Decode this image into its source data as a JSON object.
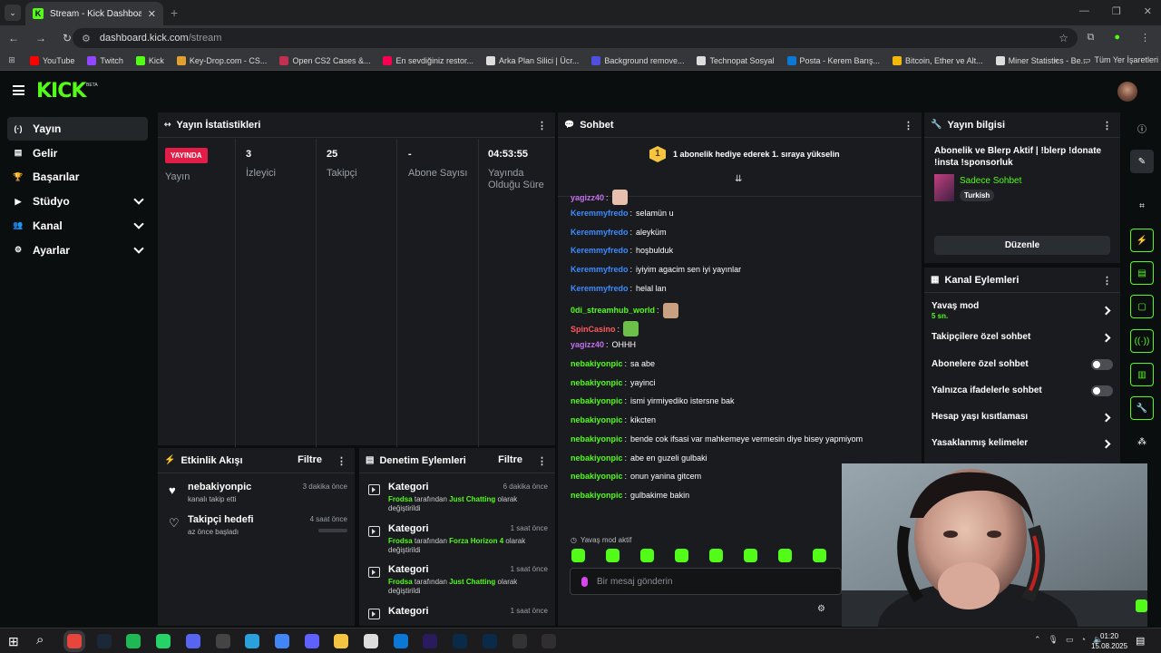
{
  "browser": {
    "tab_title": "Stream - Kick Dashboard",
    "url_host": "dashboard.kick.com",
    "url_path": "/stream",
    "bookmarks": [
      {
        "label": "YouTube",
        "color": "#ff0000"
      },
      {
        "label": "Twitch",
        "color": "#9146ff"
      },
      {
        "label": "Kick",
        "color": "#53fc18"
      },
      {
        "label": "Key-Drop.com - CS...",
        "color": "#e0a030"
      },
      {
        "label": "Open CS2 Cases &...",
        "color": "#c03050"
      },
      {
        "label": "En sevdiğiniz restor...",
        "color": "#fa0050"
      },
      {
        "label": "Arka Plan Silici | Ücr...",
        "color": "#dddddd"
      },
      {
        "label": "Background remove...",
        "color": "#5050e0"
      },
      {
        "label": "Technopat Sosyal",
        "color": "#dddddd"
      },
      {
        "label": "Posta - Kerem Barış...",
        "color": "#0a78d4"
      },
      {
        "label": "Bitcoin, Ether ve Alt...",
        "color": "#f0b90b"
      },
      {
        "label": "Miner Statistics - Be...",
        "color": "#dddddd"
      }
    ],
    "all_bookmarks": "Tüm Yer İşaretleri"
  },
  "kick": {
    "logo": "KICK",
    "beta": "BETA"
  },
  "sidebar": {
    "items": [
      {
        "label": "Yayın",
        "icon": "(·)",
        "active": true,
        "expandable": false
      },
      {
        "label": "Gelir",
        "icon": "▤",
        "active": false,
        "expandable": false
      },
      {
        "label": "Başarılar",
        "icon": "🏆",
        "active": false,
        "expandable": false
      },
      {
        "label": "Stüdyo",
        "icon": "▶",
        "active": false,
        "expandable": true
      },
      {
        "label": "Kanal",
        "icon": "👥",
        "active": false,
        "expandable": true
      },
      {
        "label": "Ayarlar",
        "icon": "⚙",
        "active": false,
        "expandable": true
      }
    ]
  },
  "stats": {
    "title": "Yayın İstatistikleri",
    "live_badge": "YAYINDA",
    "live_label": "Yayın",
    "items": [
      {
        "value": "3",
        "label": "İzleyici"
      },
      {
        "value": "25",
        "label": "Takipçi"
      },
      {
        "value": "-",
        "label": "Abone Sayısı"
      },
      {
        "value": "04:53:55",
        "label": "Yayında Olduğu Süre"
      }
    ]
  },
  "activity": {
    "title": "Etkinlik Akışı",
    "filter": "Filtre",
    "items": [
      {
        "title": "nebakiyonpic",
        "sub": "kanalı takip etti",
        "when": "3 dakika önce"
      },
      {
        "title": "Takipçi hedefi",
        "sub": "az önce başladı",
        "when": "4 saat önce"
      }
    ]
  },
  "moderation": {
    "title": "Denetim Eylemleri",
    "filter": "Filtre",
    "items": [
      {
        "title": "Kategori",
        "when": "6 dakika önce",
        "by": "Frodsa",
        "mid": "tarafından",
        "cat": "Just Chatting",
        "tail": "olarak değiştirildi"
      },
      {
        "title": "Kategori",
        "when": "1 saat önce",
        "by": "Frodsa",
        "mid": "tarafından",
        "cat": "Forza Horizon 4",
        "tail": "olarak değiştirildi"
      },
      {
        "title": "Kategori",
        "when": "1 saat önce",
        "by": "Frodsa",
        "mid": "tarafından",
        "cat": "Just Chatting",
        "tail": "olarak değiştirildi"
      },
      {
        "title": "Kategori",
        "when": "1 saat önce",
        "by": "",
        "mid": "",
        "cat": "",
        "tail": ""
      }
    ]
  },
  "chat": {
    "title": "Sohbet",
    "pinned_badge": "1",
    "pinned": "1 abonelik hediye ederek 1. sıraya yükselin",
    "slow_mode_note": "Yavaş mod aktif",
    "placeholder": "Bir mesaj gönderin",
    "messages": [
      {
        "user": "yagizz40",
        "color": "#c471ed",
        "text": "",
        "emote": "#e8c0b0"
      },
      {
        "user": "Keremmyfredo",
        "color": "#3d8bff",
        "text": "selamün u"
      },
      {
        "user": "Keremmyfredo",
        "color": "#3d8bff",
        "text": "aleyküm"
      },
      {
        "user": "Keremmyfredo",
        "color": "#3d8bff",
        "text": "hoşbulduk"
      },
      {
        "user": "Keremmyfredo",
        "color": "#3d8bff",
        "text": "iyiyim agacim sen iyi yayınlar"
      },
      {
        "user": "Keremmyfredo",
        "color": "#3d8bff",
        "text": "helal lan"
      },
      {
        "user": "0di_streamhub_world",
        "color": "#53fc18",
        "text": "",
        "emote": "#c9a080"
      },
      {
        "user": "SpinCasino",
        "color": "#ff5a5f",
        "text": "",
        "emote": "#6cc04a"
      },
      {
        "user": "yagizz40",
        "color": "#c471ed",
        "text": "OHHH"
      },
      {
        "user": "nebakiyonpic",
        "color": "#53fc18",
        "text": "sa abe"
      },
      {
        "user": "nebakiyonpic",
        "color": "#53fc18",
        "text": "yayinci"
      },
      {
        "user": "nebakiyonpic",
        "color": "#53fc18",
        "text": "ismi yirmiyediko istersne bak"
      },
      {
        "user": "nebakiyonpic",
        "color": "#53fc18",
        "text": "kikcten"
      },
      {
        "user": "nebakiyonpic",
        "color": "#53fc18",
        "text": "bende cok ifsasi var mahkemeye vermesin diye bisey yapmiyom"
      },
      {
        "user": "nebakiyonpic",
        "color": "#53fc18",
        "text": "abe en guzeli gulbaki"
      },
      {
        "user": "nebakiyonpic",
        "color": "#53fc18",
        "text": "onun yanina gitcem"
      },
      {
        "user": "nebakiyonpic",
        "color": "#53fc18",
        "text": "gulbakime bakin"
      }
    ]
  },
  "stream_info": {
    "title": "Yayın bilgisi",
    "stream_title": "Abonelik ve Blerp Aktif | !blerp !donate !insta !sponsorluk",
    "category": "Sadece Sohbet",
    "language": "Turkish",
    "edit_button": "Düzenle"
  },
  "channel_actions": {
    "title": "Kanal Eylemleri",
    "items": [
      {
        "label": "Yavaş mod",
        "sub": "5 sn.",
        "control": "chevron"
      },
      {
        "label": "Takipçilere özel sohbet",
        "sub": "",
        "control": "chevron"
      },
      {
        "label": "Abonelere özel sohbet",
        "sub": "",
        "control": "toggle"
      },
      {
        "label": "Yalnızca ifadelerle sohbet",
        "sub": "",
        "control": "toggle"
      },
      {
        "label": "Hesap yaşı kısıtlaması",
        "sub": "",
        "control": "chevron"
      },
      {
        "label": "Yasaklanmış kelimeler",
        "sub": "",
        "control": "chevron"
      }
    ]
  },
  "taskbar": {
    "time": "01:20",
    "date": "15.08.2025",
    "apps": [
      {
        "name": "chrome-icon",
        "color": "#e8453c"
      },
      {
        "name": "steam-icon",
        "color": "#1b2838"
      },
      {
        "name": "spotify-icon",
        "color": "#1db954"
      },
      {
        "name": "whatsapp-icon",
        "color": "#25d366"
      },
      {
        "name": "discord-icon",
        "color": "#5865f2"
      },
      {
        "name": "app-icon",
        "color": "#444444"
      },
      {
        "name": "telegram-icon",
        "color": "#2aa1da"
      },
      {
        "name": "chrome-alt-icon",
        "color": "#4285f4"
      },
      {
        "name": "app2-icon",
        "color": "#6060ff"
      },
      {
        "name": "folder-icon",
        "color": "#f5c542"
      },
      {
        "name": "store-icon",
        "color": "#dddddd"
      },
      {
        "name": "outlook-icon",
        "color": "#0a78d4"
      },
      {
        "name": "premiere-icon",
        "color": "#2a1a5e"
      },
      {
        "name": "photoshop-icon",
        "color": "#0a2a4a"
      },
      {
        "name": "lrc-icon",
        "color": "#0a2a4a"
      },
      {
        "name": "app3-icon",
        "color": "#333333"
      },
      {
        "name": "obs-icon",
        "color": "#302e31"
      }
    ]
  }
}
